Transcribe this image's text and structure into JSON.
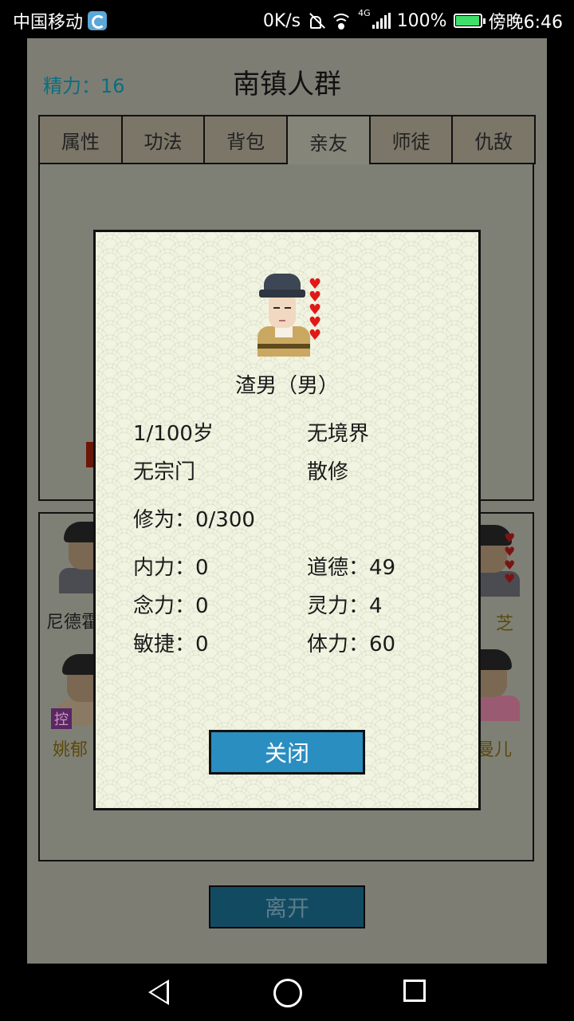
{
  "status_bar": {
    "carrier": "中国移动",
    "net_speed": "0K/s",
    "network_type": "4G",
    "battery": "100%",
    "time": "傍晚6:46",
    "icons": [
      "app-icon",
      "mute-icon",
      "wifi-icon",
      "signal-icon",
      "battery-icon"
    ]
  },
  "header": {
    "energy": "精力：16",
    "title": "南镇人群"
  },
  "tabs": [
    {
      "label": "属性"
    },
    {
      "label": "功法"
    },
    {
      "label": "背包"
    },
    {
      "label": "亲友",
      "active": true
    },
    {
      "label": "师徒"
    },
    {
      "label": "仇敌"
    }
  ],
  "background_npcs": [
    {
      "name": "尼德霍"
    },
    {
      "name": "芝"
    },
    {
      "name": "姚郁"
    },
    {
      "name": "曼儿"
    }
  ],
  "background_badge": "控",
  "leave_button": "离开",
  "modal": {
    "name": "渣男（男）",
    "hearts": "♥♥♥♥♥",
    "age": "1/100岁",
    "realm": "无境界",
    "sect": "无宗门",
    "sect_status": "散修",
    "cultivation": "修为：0/300",
    "stats": {
      "neili": "内力：0",
      "daode": "道德：49",
      "nianli": "念力：0",
      "lingli": "灵力：4",
      "minjie": "敏捷：0",
      "tili": "体力：60"
    },
    "close_button": "关闭"
  },
  "colors": {
    "energy_text": "#0a6f7f",
    "close_button_bg": "#2a8ec0",
    "heart": "#e01818"
  }
}
